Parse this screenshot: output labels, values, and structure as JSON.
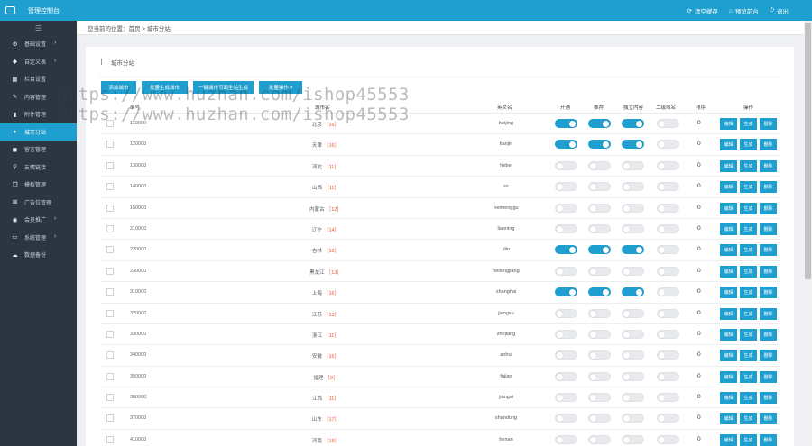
{
  "header": {
    "title": "管理控制台",
    "links": [
      {
        "icon": "refresh-icon",
        "label": "清空缓存"
      },
      {
        "icon": "home-icon",
        "label": "预览前台"
      },
      {
        "icon": "power-icon",
        "label": "退出"
      }
    ]
  },
  "sidebar": {
    "items": [
      {
        "icon": "gear-icon",
        "label": "基础设置",
        "has_sub": true
      },
      {
        "icon": "tag-icon",
        "label": "自定义表",
        "has_sub": true
      },
      {
        "icon": "grid-icon",
        "label": "栏目设置",
        "has_sub": false
      },
      {
        "icon": "edit-icon",
        "label": "内容管理",
        "has_sub": false
      },
      {
        "icon": "chart-icon",
        "label": "附件管理",
        "has_sub": false
      },
      {
        "icon": "globe-icon",
        "label": "城市分站",
        "has_sub": false,
        "active": true
      },
      {
        "icon": "comment-icon",
        "label": "留言管理",
        "has_sub": false
      },
      {
        "icon": "link-icon",
        "label": "友情链接",
        "has_sub": false
      },
      {
        "icon": "copy-icon",
        "label": "模板管理",
        "has_sub": false
      },
      {
        "icon": "close-box-icon",
        "label": "广告位管理",
        "has_sub": false
      },
      {
        "icon": "users-icon",
        "label": "会员推广",
        "has_sub": true
      },
      {
        "icon": "monitor-icon",
        "label": "系统管理",
        "has_sub": true
      },
      {
        "icon": "cloud-icon",
        "label": "数据备份",
        "has_sub": false
      }
    ]
  },
  "breadcrumb": "您当前的位置：首页 > 城市分站",
  "panel": {
    "title": "城市分站",
    "buttons": [
      "添加城市",
      "批量生成城市",
      "一键城市页面全站生成",
      "批量操作 ▾"
    ]
  },
  "table": {
    "headers": [
      "编号",
      "城市名",
      "英文名",
      "开通",
      "推荐",
      "独立内容",
      "二级域名",
      "排序",
      "操作"
    ],
    "row_actions": [
      "编辑",
      "生成",
      "删除"
    ],
    "rows": [
      {
        "code": "110000",
        "name": "北京",
        "count": "［16］",
        "pinyin": "beijing",
        "open": true,
        "rec": true,
        "indep": true,
        "sub": false,
        "sort": "0"
      },
      {
        "code": "120000",
        "name": "天津",
        "count": "［16］",
        "pinyin": "tianjin",
        "open": true,
        "rec": true,
        "indep": true,
        "sub": false,
        "sort": "0"
      },
      {
        "code": "130000",
        "name": "河北",
        "count": "［11］",
        "pinyin": "hebei",
        "open": false,
        "rec": false,
        "indep": false,
        "sub": false,
        "sort": "0"
      },
      {
        "code": "140000",
        "name": "山西",
        "count": "［11］",
        "pinyin": "sx",
        "open": false,
        "rec": false,
        "indep": false,
        "sub": false,
        "sort": "0"
      },
      {
        "code": "150000",
        "name": "内蒙古",
        "count": "［12］",
        "pinyin": "neimenggu",
        "open": false,
        "rec": false,
        "indep": false,
        "sub": false,
        "sort": "0"
      },
      {
        "code": "210000",
        "name": "辽宁",
        "count": "［14］",
        "pinyin": "liaoning",
        "open": false,
        "rec": false,
        "indep": false,
        "sub": false,
        "sort": "0"
      },
      {
        "code": "220000",
        "name": "吉林",
        "count": "［16］",
        "pinyin": "jilin",
        "open": true,
        "rec": true,
        "indep": true,
        "sub": false,
        "sort": "0"
      },
      {
        "code": "230000",
        "name": "黑龙江",
        "count": "［13］",
        "pinyin": "heilongjiang",
        "open": false,
        "rec": false,
        "indep": false,
        "sub": false,
        "sort": "0"
      },
      {
        "code": "310000",
        "name": "上海",
        "count": "［16］",
        "pinyin": "shanghai",
        "open": true,
        "rec": true,
        "indep": true,
        "sub": false,
        "sort": "0"
      },
      {
        "code": "320000",
        "name": "江苏",
        "count": "［13］",
        "pinyin": "jiangsu",
        "open": false,
        "rec": false,
        "indep": false,
        "sub": false,
        "sort": "0"
      },
      {
        "code": "330000",
        "name": "浙江",
        "count": "［11］",
        "pinyin": "zhejiang",
        "open": false,
        "rec": false,
        "indep": false,
        "sub": false,
        "sort": "0"
      },
      {
        "code": "340000",
        "name": "安徽",
        "count": "［16］",
        "pinyin": "anhui",
        "open": false,
        "rec": false,
        "indep": false,
        "sub": false,
        "sort": "0"
      },
      {
        "code": "350000",
        "name": "福建",
        "count": "［9］",
        "pinyin": "fujian",
        "open": false,
        "rec": false,
        "indep": false,
        "sub": false,
        "sort": "0"
      },
      {
        "code": "360000",
        "name": "江西",
        "count": "［11］",
        "pinyin": "jiangxi",
        "open": false,
        "rec": false,
        "indep": false,
        "sub": false,
        "sort": "0"
      },
      {
        "code": "370000",
        "name": "山东",
        "count": "［17］",
        "pinyin": "shandong",
        "open": false,
        "rec": false,
        "indep": false,
        "sub": false,
        "sort": "0"
      },
      {
        "code": "410000",
        "name": "河南",
        "count": "［18］",
        "pinyin": "henan",
        "open": false,
        "rec": false,
        "indep": false,
        "sub": false,
        "sort": "0"
      }
    ]
  },
  "watermark": [
    "https://www.huzhan.com/ishop45553",
    "https://www.huzhan.com/ishop45553"
  ],
  "colors": {
    "accent": "#1e9fcf",
    "sidebar": "#2c3642",
    "count": "#e8542f"
  }
}
